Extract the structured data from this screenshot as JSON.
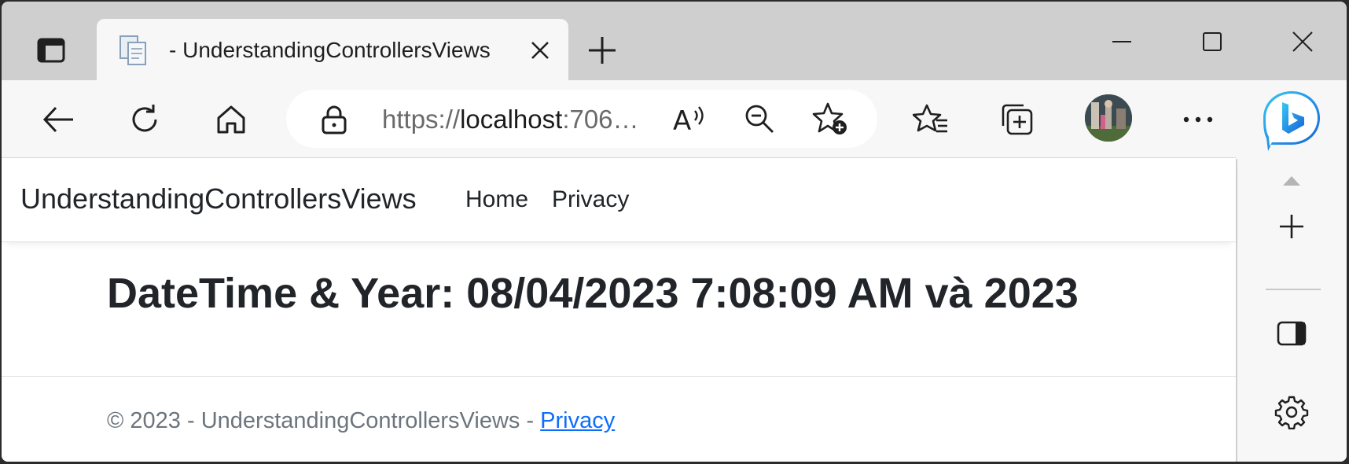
{
  "browser": {
    "tab": {
      "title": "- UnderstandingControllersViews"
    },
    "address_bar": {
      "scheme": "https://",
      "host": "localhost",
      "rest": ":706…"
    },
    "icons": {
      "tab_actions": "tab-actions-icon",
      "favicon": "document-icon",
      "tab_close": "close-icon",
      "new_tab": "plus-icon",
      "minimize": "minimize-icon",
      "maximize": "maximize-icon",
      "close_window": "close-icon",
      "back": "back-arrow-icon",
      "refresh": "refresh-icon",
      "home": "home-icon",
      "lock": "lock-icon",
      "read_aloud": "read-aloud-icon",
      "zoom_out": "zoom-out-icon",
      "add_favorite": "star-plus-icon",
      "favorites": "favorites-icon",
      "collections": "collections-icon",
      "profile": "avatar",
      "more": "more-icon",
      "copilot": "bing-icon"
    }
  },
  "page": {
    "navbar": {
      "brand": "UnderstandingControllersViews",
      "links": [
        "Home",
        "Privacy"
      ]
    },
    "heading": "DateTime & Year: 08/04/2023 7:08:09 AM và 2023",
    "footer": {
      "text": "© 2023 - UnderstandingControllersViews - ",
      "link": "Privacy"
    }
  },
  "sidebar": {
    "icons": [
      "chevron-up-icon",
      "plus-icon",
      "split-screen-icon",
      "gear-icon"
    ]
  },
  "colors": {
    "link": "#0d6efd",
    "text": "#212529",
    "muted": "#6c757d",
    "bing_blue": "#1a73e8"
  }
}
